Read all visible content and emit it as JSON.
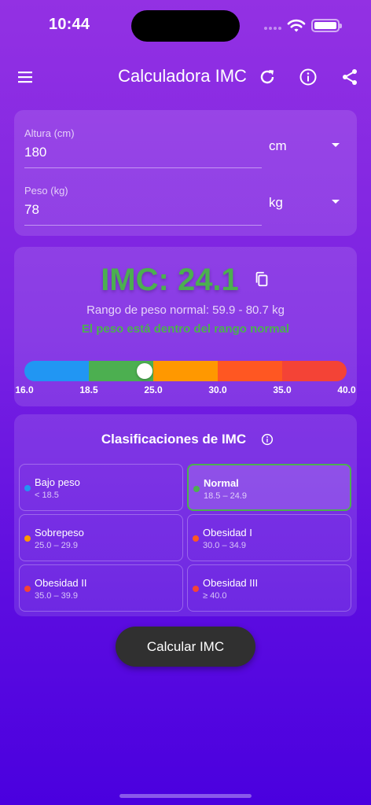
{
  "status_bar": {
    "time": "10:44"
  },
  "app_bar": {
    "title": "Calculadora IMC",
    "icons": [
      "menu-icon",
      "refresh-icon",
      "info-icon",
      "share-icon"
    ]
  },
  "inputs": {
    "height": {
      "label": "Altura (cm)",
      "value": "180",
      "unit": "cm"
    },
    "weight": {
      "label": "Peso (kg)",
      "value": "78",
      "unit": "kg"
    }
  },
  "result": {
    "bmi_text": "IMC: 24.1",
    "bmi_value": 24.1,
    "normal_range": "Rango de peso normal: 59.9 - 80.7 kg",
    "status": "El peso está dentro del rango normal",
    "status_color": "#4caf50"
  },
  "scale": {
    "ticks": [
      "16.0",
      "18.5",
      "25.0",
      "30.0",
      "35.0",
      "40.0"
    ],
    "colors": [
      "#2196f3",
      "#4caf50",
      "#ff9800",
      "#ff5722",
      "#f44336"
    ]
  },
  "classifications": {
    "title": "Clasificaciones de IMC",
    "items": [
      {
        "name": "Bajo peso",
        "range": "< 18.5",
        "color": "#2196f3",
        "active": false
      },
      {
        "name": "Normal",
        "range": "18.5 – 24.9",
        "color": "#4caf50",
        "active": true
      },
      {
        "name": "Sobrepeso",
        "range": "25.0 – 29.9",
        "color": "#ff9800",
        "active": false
      },
      {
        "name": "Obesidad I",
        "range": "30.0 – 34.9",
        "color": "#ff5722",
        "active": false
      },
      {
        "name": "Obesidad II",
        "range": "35.0 – 39.9",
        "color": "#f44336",
        "active": false
      },
      {
        "name": "Obesidad III",
        "range": "≥ 40.0",
        "color": "#f44336",
        "active": false
      }
    ]
  },
  "action": {
    "calculate_label": "Calcular IMC"
  }
}
